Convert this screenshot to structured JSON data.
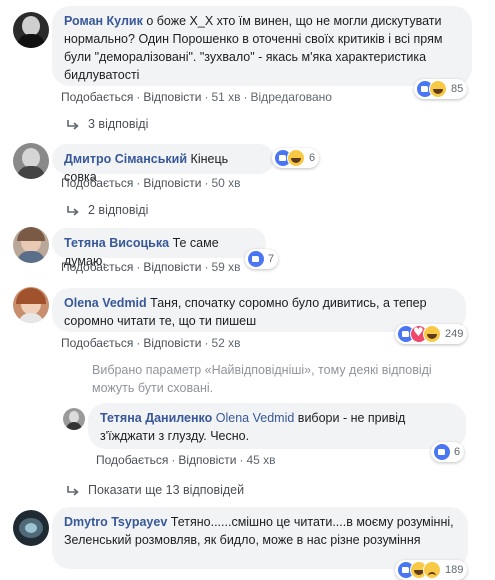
{
  "comments": [
    {
      "author": "Роман Кулик",
      "text": "о боже X_X хто їм винен, що не могли дискутувати нормально? Один Порошенко в оточенні своїх критиків і всі прям були \"деморалізовані\". \"зухвало\" - якась м'яка характеристика бидлуватості",
      "like_label": "Подобається",
      "reply_label": "Відповісти",
      "time": "51 хв",
      "edited_label": "Відредаговано",
      "reaction_count": "85",
      "replies_link": "3 відповіді"
    },
    {
      "author": "Дмитро Сіманський",
      "text": "Кінець совка",
      "like_label": "Подобається",
      "reply_label": "Відповісти",
      "time": "50 хв",
      "reaction_count": "6",
      "replies_link": "2 відповіді"
    },
    {
      "author": "Тетяна Висоцька",
      "text": "Те саме думаю.",
      "like_label": "Подобається",
      "reply_label": "Відповісти",
      "time": "59 хв",
      "reaction_count": "7"
    },
    {
      "author": "Olena Vedmid",
      "text": "Таня, спочатку соромно було дивитись, а тепер соромно читати те, що ти пишеш",
      "like_label": "Подобається",
      "reply_label": "Відповісти",
      "time": "52 хв",
      "reaction_count": "249"
    },
    {
      "author": "Dmytro Tsypayev",
      "text": "Тетяно......смішно це читати....в моєму розумінні, Зеленський розмовляв, як бидло, може в нас різне розуміння",
      "reaction_count": "189"
    }
  ],
  "filter_note": "Вибрано параметр «Найвідповідніші», тому деякі відповіді можуть бути сховані.",
  "reply": {
    "author": "Тетяна Даниленко",
    "mention": "Olena Vedmid",
    "text": "вибори - не привід з'їжджати з глузду. Чесно.",
    "like_label": "Подобається",
    "reply_label": "Відповісти",
    "time": "45 хв",
    "reaction_count": "6"
  },
  "more_replies_link": "Показати ще 13 відповідей",
  "colors": {
    "link": "#385898",
    "bubble": "#f2f3f5",
    "meta": "#606770",
    "note": "#90949c"
  }
}
